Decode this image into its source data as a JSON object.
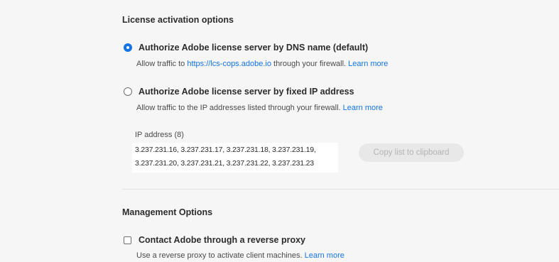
{
  "license_section": {
    "title": "License activation options",
    "dns_option": {
      "label": "Authorize Adobe license server by DNS name (default)",
      "selected": true,
      "desc_prefix": "Allow traffic to ",
      "desc_link": "https://lcs-cops.adobe.io",
      "desc_suffix": " through your firewall. ",
      "learn_more": "Learn more"
    },
    "ip_option": {
      "label": "Authorize Adobe license server by fixed IP address",
      "selected": false,
      "desc": "Allow traffic to the IP addresses listed through your firewall. ",
      "learn_more": "Learn more"
    },
    "ip_list": {
      "label": "IP address (8)",
      "line1": "3.237.231.16, 3.237.231.17, 3.237.231.18, 3.237.231.19,",
      "line2": "3.237.231.20, 3.237.231.21, 3.237.231.22, 3.237.231.23"
    },
    "copy_button": "Copy list to clipboard"
  },
  "management_section": {
    "title": "Management Options",
    "proxy_option": {
      "label": "Contact Adobe through a reverse proxy",
      "checked": false,
      "desc": "Use a reverse proxy to activate client machines. ",
      "learn_more": "Learn more"
    }
  },
  "colors": {
    "accent": "#1473e6",
    "background": "#f6f6f6",
    "text": "#2c2c2c",
    "button_disabled_bg": "#e8e8e8",
    "button_disabled_text": "#b3b3b3"
  }
}
